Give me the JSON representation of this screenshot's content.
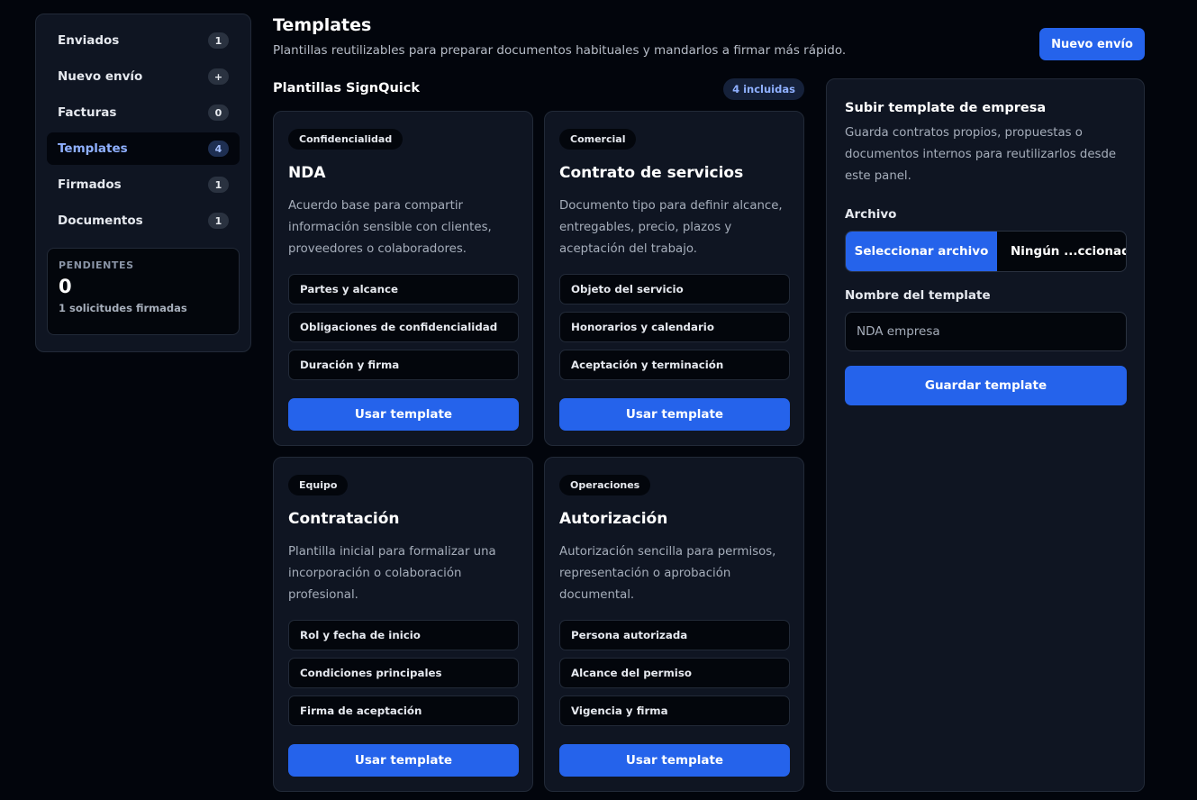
{
  "sidebar": {
    "items": [
      {
        "label": "Enviados",
        "badge": "1"
      },
      {
        "label": "Nuevo envío",
        "badge": "+"
      },
      {
        "label": "Facturas",
        "badge": "0"
      },
      {
        "label": "Templates",
        "badge": "4",
        "active": true
      },
      {
        "label": "Firmados",
        "badge": "1"
      },
      {
        "label": "Documentos",
        "badge": "1"
      }
    ],
    "pending": {
      "title": "PENDIENTES",
      "count": "0",
      "subtitle": "1 solicitudes firmadas"
    }
  },
  "header": {
    "title": "Templates",
    "subtitle": "Plantillas reutilizables para preparar documentos habituales y mandarlos a firmar más rápido.",
    "new_send_label": "Nuevo envío"
  },
  "templates_section": {
    "title": "Plantillas SignQuick",
    "count_badge": "4 incluidas",
    "cards": [
      {
        "tag": "Confidencialidad",
        "title": "NDA",
        "description": "Acuerdo base para compartir información sensible con clientes, proveedores o colaboradores.",
        "items": [
          "Partes y alcance",
          "Obligaciones de confidencialidad",
          "Duración y firma"
        ],
        "button": "Usar template"
      },
      {
        "tag": "Comercial",
        "title": "Contrato de servicios",
        "description": "Documento tipo para definir alcance, entregables, precio, plazos y aceptación del trabajo.",
        "items": [
          "Objeto del servicio",
          "Honorarios y calendario",
          "Aceptación y terminación"
        ],
        "button": "Usar template"
      },
      {
        "tag": "Equipo",
        "title": "Contratación",
        "description": "Plantilla inicial para formalizar una incorporación o colaboración profesional.",
        "items": [
          "Rol y fecha de inicio",
          "Condiciones principales",
          "Firma de aceptación"
        ],
        "button": "Usar template"
      },
      {
        "tag": "Operaciones",
        "title": "Autorización",
        "description": "Autorización sencilla para permisos, representación o aprobación documental.",
        "items": [
          "Persona autorizada",
          "Alcance del permiso",
          "Vigencia y firma"
        ],
        "button": "Usar template"
      }
    ]
  },
  "upload_panel": {
    "title": "Subir template de empresa",
    "description": "Guarda contratos propios, propuestas o documentos internos para reutilizarlos desde este panel.",
    "file_label": "Archivo",
    "file_button": "Seleccionar archivo",
    "file_name": "Ningún ...ccionado",
    "name_label": "Nombre del template",
    "name_placeholder": "NDA empresa",
    "save_button": "Guardar template"
  },
  "colors": {
    "background": "#02050c",
    "panel": "#0f1522",
    "accent": "#2563eb",
    "active_text": "#8fb0ff"
  }
}
